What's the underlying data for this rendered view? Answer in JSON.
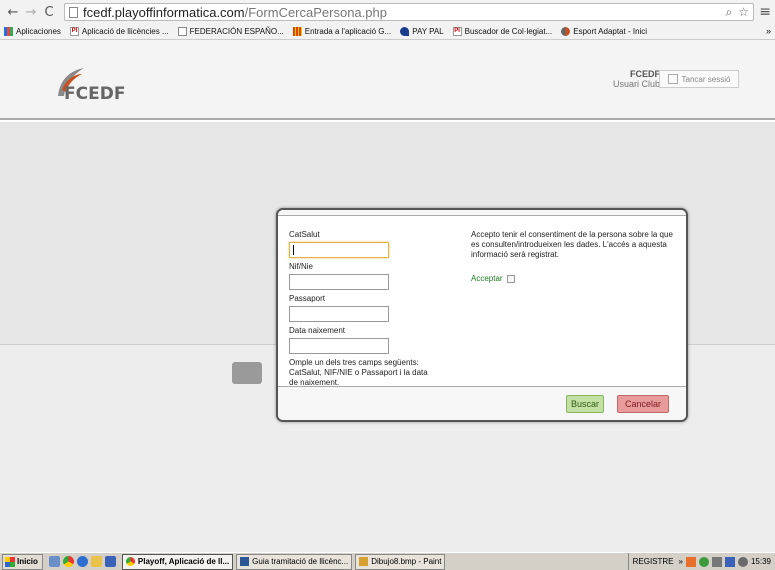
{
  "browser": {
    "url_host": "fcedf.playoffinformatica.com",
    "url_path": "/FormCercaPersona.php",
    "bookmarks": [
      {
        "label": "Aplicaciones",
        "icon": "apps-grid-icon"
      },
      {
        "label": "Aplicació de llicències ...",
        "icon": "pi-icon"
      },
      {
        "label": "FEDERACIÓN ESPAÑO...",
        "icon": "page-icon"
      },
      {
        "label": "Entrada a l'aplicació G...",
        "icon": "gencat-icon"
      },
      {
        "label": "PAY PAL",
        "icon": "paypal-icon"
      },
      {
        "label": "Buscador de Col·legiat...",
        "icon": "pi-icon"
      },
      {
        "label": "Esport Adaptat - Inici",
        "icon": "fcedf-icon"
      }
    ],
    "more": "»"
  },
  "header": {
    "logo_text": "FCEDF",
    "user_org": "FCEDF",
    "user_role": "Usuari Club",
    "logout_label": "Tancar sessió"
  },
  "modal": {
    "fields": [
      {
        "label": "CatSalut",
        "value": ""
      },
      {
        "label": "Nif/Nie",
        "value": ""
      },
      {
        "label": "Passaport",
        "value": ""
      },
      {
        "label": "Data naixement",
        "value": ""
      }
    ],
    "hint": "Omple un dels tres camps següents: CatSalut, NIF/NIE o Passaport i la data de naixement.",
    "consent": "Accepto tenir el consentiment de la persona sobre la que es consulten/introdueixen les dades. L'accés a aquesta informació serà registrat.",
    "accept_label": "Acceptar",
    "accept_checked": false,
    "search_label": "Buscar",
    "cancel_label": "Cancelar"
  },
  "taskbar": {
    "start_label": "Inicio",
    "tasks": [
      {
        "label": "Playoff, Aplicació de ll...",
        "active": true
      },
      {
        "label": "Guia tramitació de llicènc...",
        "active": false
      },
      {
        "label": "Dibujo8.bmp - Paint",
        "active": false
      }
    ],
    "tray_label": "REGISTRE",
    "tray_more": "»",
    "clock": "15:39"
  }
}
